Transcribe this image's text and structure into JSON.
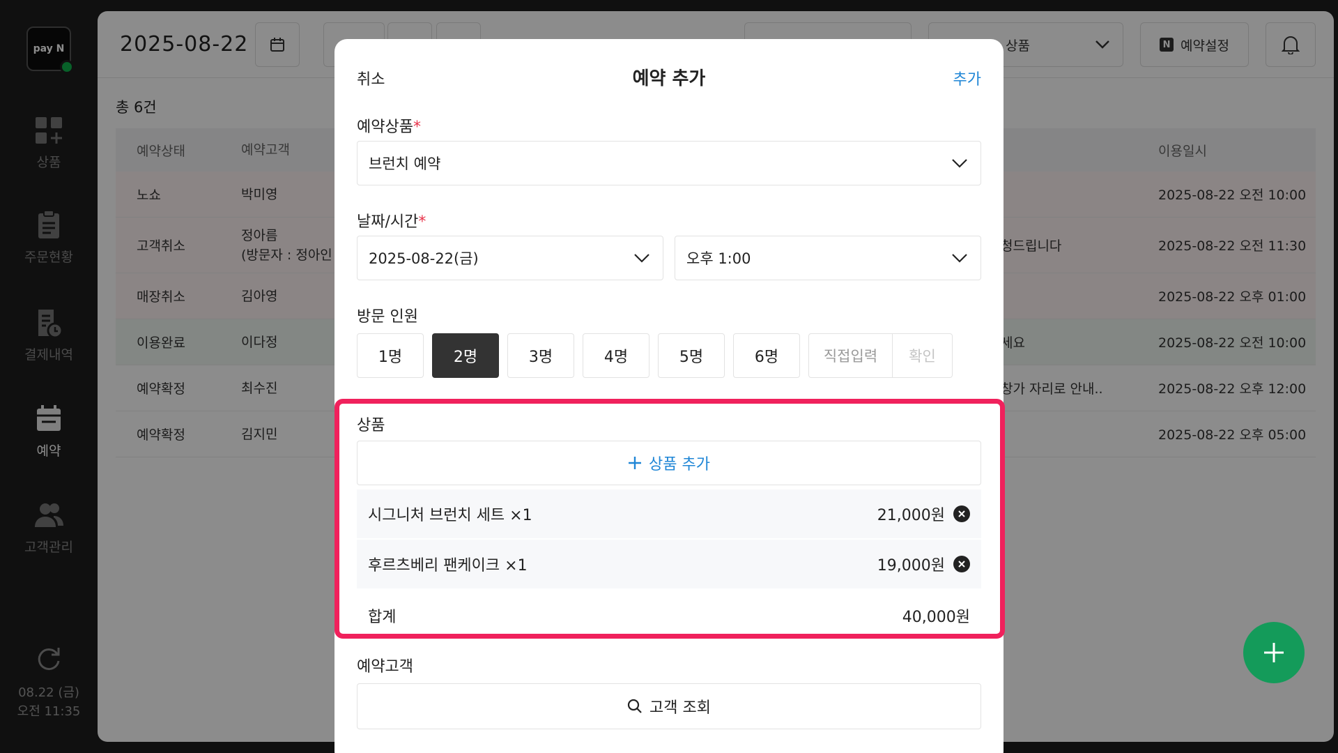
{
  "sidebar": {
    "logo": "pay N",
    "items": [
      {
        "label": "상품",
        "icon": "grid-plus-icon"
      },
      {
        "label": "주문현황",
        "icon": "clipboard-icon"
      },
      {
        "label": "결제내역",
        "icon": "receipt-clock-icon"
      },
      {
        "label": "예약",
        "icon": "calendar-icon"
      },
      {
        "label": "고객관리",
        "icon": "users-icon"
      }
    ],
    "date": "08.22 (금)",
    "time": "오전 11:35"
  },
  "header": {
    "date": "2025-08-22",
    "product_filter": "상품",
    "settings": "예약설정"
  },
  "list": {
    "total": "총 6건",
    "columns": {
      "status": "예약상태",
      "customer": "예약고객",
      "datetime": "이용일시"
    },
    "rows": [
      {
        "status": "노쇼",
        "customer": "박미영",
        "customer2": "",
        "memo": "",
        "datetime": "2025-08-22 오전 10:00"
      },
      {
        "status": "고객취소",
        "customer": "정아름",
        "customer2": "(방문자 : 정아인",
        "memo": "청드립니다",
        "datetime": "2025-08-22 오전 11:30"
      },
      {
        "status": "매장취소",
        "customer": "김아영",
        "customer2": "",
        "memo": "",
        "datetime": "2025-08-22 오후 01:00"
      },
      {
        "status": "이용완료",
        "customer": "이다정",
        "customer2": "",
        "memo": "세요",
        "datetime": "2025-08-22 오전 10:00"
      },
      {
        "status": "예약확정",
        "customer": "최수진",
        "customer2": "",
        "memo": "창가 자리로 안내..",
        "datetime": "2025-08-22 오후 12:00"
      },
      {
        "status": "예약확정",
        "customer": "김지민",
        "customer2": "",
        "memo": "",
        "datetime": "2025-08-22 오후 05:00"
      }
    ]
  },
  "modal": {
    "cancel": "취소",
    "title": "예약 추가",
    "add": "추가",
    "product_label": "예약상품",
    "product_value": "브런치 예약",
    "datetime_label": "날짜/시간",
    "date_value": "2025-08-22(금)",
    "time_value": "오후 1:00",
    "people_label": "방문 인원",
    "people_options": [
      "1명",
      "2명",
      "3명",
      "4명",
      "5명",
      "6명"
    ],
    "people_selected": "2명",
    "direct_input": "직접입력",
    "direct_confirm": "확인",
    "goods_label": "상품",
    "add_goods": "상품 추가",
    "goods": [
      {
        "name": "시그니처 브런치 세트 ×1",
        "price": "21,000원"
      },
      {
        "name": "후르츠베리 팬케이크 ×1",
        "price": "19,000원"
      }
    ],
    "sum_label": "합계",
    "sum_value": "40,000원",
    "customer_label": "예약고객",
    "customer_search": "고객 조회"
  },
  "colors": {
    "accent": "#1f86d6",
    "highlight": "#f0215c",
    "fab": "#149b5a",
    "online": "#10b14c"
  }
}
